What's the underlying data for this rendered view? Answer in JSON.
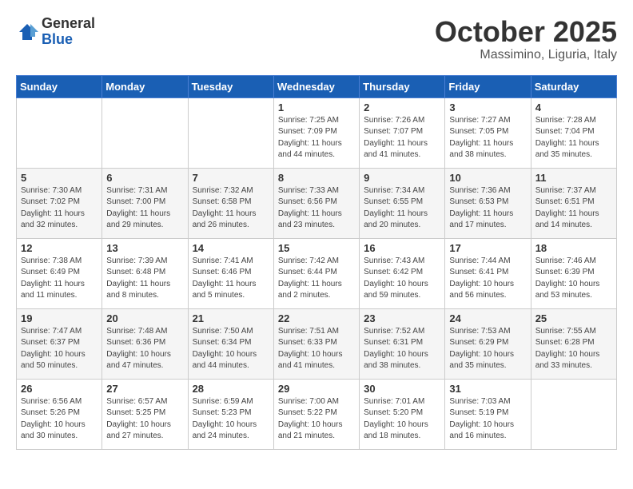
{
  "header": {
    "logo_general": "General",
    "logo_blue": "Blue",
    "month": "October 2025",
    "location": "Massimino, Liguria, Italy"
  },
  "days_of_week": [
    "Sunday",
    "Monday",
    "Tuesday",
    "Wednesday",
    "Thursday",
    "Friday",
    "Saturday"
  ],
  "weeks": [
    [
      {
        "day": "",
        "info": ""
      },
      {
        "day": "",
        "info": ""
      },
      {
        "day": "",
        "info": ""
      },
      {
        "day": "1",
        "info": "Sunrise: 7:25 AM\nSunset: 7:09 PM\nDaylight: 11 hours\nand 44 minutes."
      },
      {
        "day": "2",
        "info": "Sunrise: 7:26 AM\nSunset: 7:07 PM\nDaylight: 11 hours\nand 41 minutes."
      },
      {
        "day": "3",
        "info": "Sunrise: 7:27 AM\nSunset: 7:05 PM\nDaylight: 11 hours\nand 38 minutes."
      },
      {
        "day": "4",
        "info": "Sunrise: 7:28 AM\nSunset: 7:04 PM\nDaylight: 11 hours\nand 35 minutes."
      }
    ],
    [
      {
        "day": "5",
        "info": "Sunrise: 7:30 AM\nSunset: 7:02 PM\nDaylight: 11 hours\nand 32 minutes."
      },
      {
        "day": "6",
        "info": "Sunrise: 7:31 AM\nSunset: 7:00 PM\nDaylight: 11 hours\nand 29 minutes."
      },
      {
        "day": "7",
        "info": "Sunrise: 7:32 AM\nSunset: 6:58 PM\nDaylight: 11 hours\nand 26 minutes."
      },
      {
        "day": "8",
        "info": "Sunrise: 7:33 AM\nSunset: 6:56 PM\nDaylight: 11 hours\nand 23 minutes."
      },
      {
        "day": "9",
        "info": "Sunrise: 7:34 AM\nSunset: 6:55 PM\nDaylight: 11 hours\nand 20 minutes."
      },
      {
        "day": "10",
        "info": "Sunrise: 7:36 AM\nSunset: 6:53 PM\nDaylight: 11 hours\nand 17 minutes."
      },
      {
        "day": "11",
        "info": "Sunrise: 7:37 AM\nSunset: 6:51 PM\nDaylight: 11 hours\nand 14 minutes."
      }
    ],
    [
      {
        "day": "12",
        "info": "Sunrise: 7:38 AM\nSunset: 6:49 PM\nDaylight: 11 hours\nand 11 minutes."
      },
      {
        "day": "13",
        "info": "Sunrise: 7:39 AM\nSunset: 6:48 PM\nDaylight: 11 hours\nand 8 minutes."
      },
      {
        "day": "14",
        "info": "Sunrise: 7:41 AM\nSunset: 6:46 PM\nDaylight: 11 hours\nand 5 minutes."
      },
      {
        "day": "15",
        "info": "Sunrise: 7:42 AM\nSunset: 6:44 PM\nDaylight: 11 hours\nand 2 minutes."
      },
      {
        "day": "16",
        "info": "Sunrise: 7:43 AM\nSunset: 6:42 PM\nDaylight: 10 hours\nand 59 minutes."
      },
      {
        "day": "17",
        "info": "Sunrise: 7:44 AM\nSunset: 6:41 PM\nDaylight: 10 hours\nand 56 minutes."
      },
      {
        "day": "18",
        "info": "Sunrise: 7:46 AM\nSunset: 6:39 PM\nDaylight: 10 hours\nand 53 minutes."
      }
    ],
    [
      {
        "day": "19",
        "info": "Sunrise: 7:47 AM\nSunset: 6:37 PM\nDaylight: 10 hours\nand 50 minutes."
      },
      {
        "day": "20",
        "info": "Sunrise: 7:48 AM\nSunset: 6:36 PM\nDaylight: 10 hours\nand 47 minutes."
      },
      {
        "day": "21",
        "info": "Sunrise: 7:50 AM\nSunset: 6:34 PM\nDaylight: 10 hours\nand 44 minutes."
      },
      {
        "day": "22",
        "info": "Sunrise: 7:51 AM\nSunset: 6:33 PM\nDaylight: 10 hours\nand 41 minutes."
      },
      {
        "day": "23",
        "info": "Sunrise: 7:52 AM\nSunset: 6:31 PM\nDaylight: 10 hours\nand 38 minutes."
      },
      {
        "day": "24",
        "info": "Sunrise: 7:53 AM\nSunset: 6:29 PM\nDaylight: 10 hours\nand 35 minutes."
      },
      {
        "day": "25",
        "info": "Sunrise: 7:55 AM\nSunset: 6:28 PM\nDaylight: 10 hours\nand 33 minutes."
      }
    ],
    [
      {
        "day": "26",
        "info": "Sunrise: 6:56 AM\nSunset: 5:26 PM\nDaylight: 10 hours\nand 30 minutes."
      },
      {
        "day": "27",
        "info": "Sunrise: 6:57 AM\nSunset: 5:25 PM\nDaylight: 10 hours\nand 27 minutes."
      },
      {
        "day": "28",
        "info": "Sunrise: 6:59 AM\nSunset: 5:23 PM\nDaylight: 10 hours\nand 24 minutes."
      },
      {
        "day": "29",
        "info": "Sunrise: 7:00 AM\nSunset: 5:22 PM\nDaylight: 10 hours\nand 21 minutes."
      },
      {
        "day": "30",
        "info": "Sunrise: 7:01 AM\nSunset: 5:20 PM\nDaylight: 10 hours\nand 18 minutes."
      },
      {
        "day": "31",
        "info": "Sunrise: 7:03 AM\nSunset: 5:19 PM\nDaylight: 10 hours\nand 16 minutes."
      },
      {
        "day": "",
        "info": ""
      }
    ]
  ]
}
